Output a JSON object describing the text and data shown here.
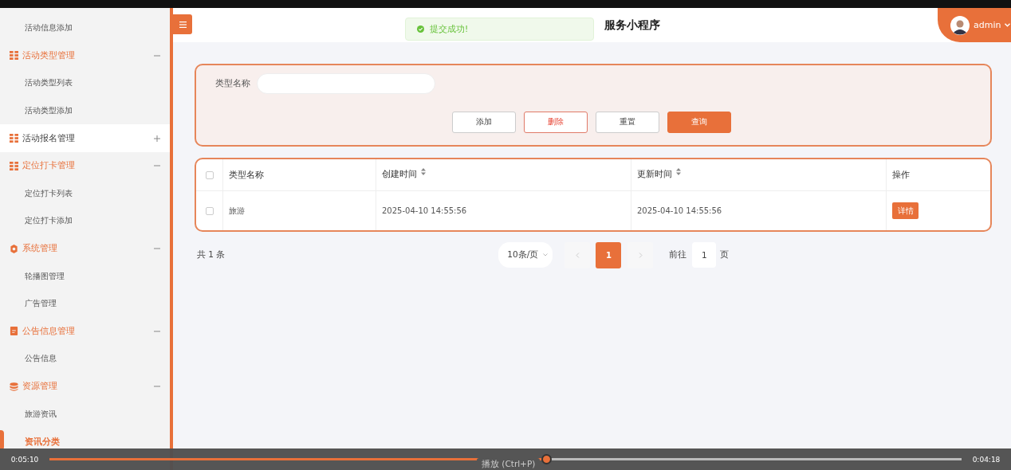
{
  "sidebar": {
    "items": [
      {
        "kind": "sub",
        "label": "活动信息添加",
        "selected": false
      },
      {
        "kind": "group",
        "label": "活动类型管理",
        "expanded": true,
        "selected": false
      },
      {
        "kind": "sub",
        "label": "活动类型列表",
        "selected": false
      },
      {
        "kind": "sub",
        "label": "活动类型添加",
        "selected": false
      },
      {
        "kind": "group",
        "label": "活动报名管理",
        "expanded": false,
        "selected": true
      },
      {
        "kind": "group",
        "label": "定位打卡管理",
        "expanded": true,
        "selected": false
      },
      {
        "kind": "sub",
        "label": "定位打卡列表",
        "selected": false
      },
      {
        "kind": "sub",
        "label": "定位打卡添加",
        "selected": false
      },
      {
        "kind": "group",
        "label": "系统管理",
        "expanded": true,
        "selected": false
      },
      {
        "kind": "sub",
        "label": "轮播图管理",
        "selected": false
      },
      {
        "kind": "sub",
        "label": "广告管理",
        "selected": false
      },
      {
        "kind": "group",
        "label": "公告信息管理",
        "expanded": true,
        "selected": false
      },
      {
        "kind": "sub",
        "label": "公告信息",
        "selected": false
      },
      {
        "kind": "group",
        "label": "资源管理",
        "expanded": true,
        "selected": false
      },
      {
        "kind": "sub",
        "label": "旅游资讯",
        "selected": false
      },
      {
        "kind": "sub",
        "label": "资讯分类",
        "selected": true
      }
    ]
  },
  "header": {
    "title": "服务小程序",
    "user": "admin"
  },
  "toast": {
    "message": "提交成功!"
  },
  "search": {
    "label": "类型名称",
    "buttons": [
      {
        "label": "添加",
        "kind": "default"
      },
      {
        "label": "删除",
        "kind": "danger"
      },
      {
        "label": "重置",
        "kind": "default"
      },
      {
        "label": "查询",
        "kind": "primary"
      }
    ]
  },
  "table": {
    "all_checked": false,
    "columns": [
      {
        "label": "类型名称",
        "sortable": false
      },
      {
        "label": "创建时间",
        "sortable": true
      },
      {
        "label": "更新时间",
        "sortable": true
      },
      {
        "label": "操作",
        "sortable": false
      }
    ],
    "rows": [
      {
        "checked": false,
        "cells": [
          "旅游",
          "2025-04-10 14:55:56",
          "2025-04-10 14:55:56"
        ],
        "action": "详情"
      }
    ]
  },
  "pagination": {
    "total": "共 1 条",
    "page_size": "10条/页",
    "pages": [
      {
        "label": "1",
        "selected": true
      }
    ],
    "goto_label": "前往",
    "goto_value": "1",
    "goto_suffix": "页"
  },
  "player": {
    "elapsed": "0:05:10",
    "remaining": "0:04:18",
    "level": 0.545,
    "tooltip": "播放 (Ctrl+P)"
  }
}
